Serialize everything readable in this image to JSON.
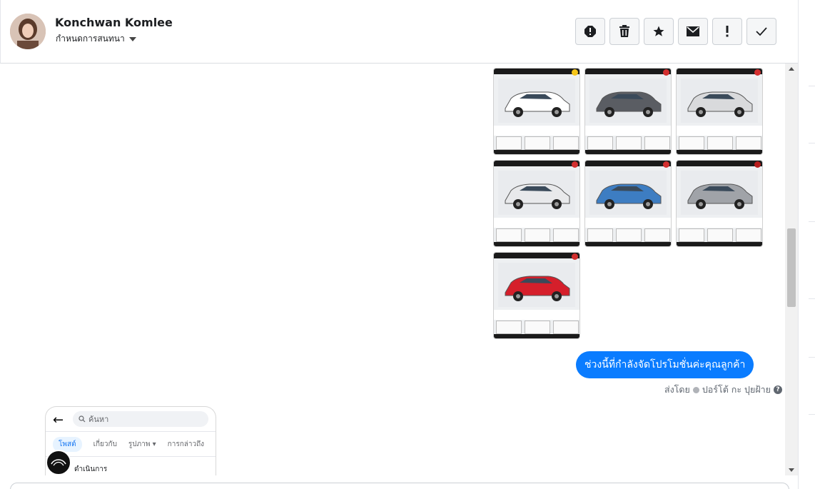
{
  "header": {
    "name": "Konchwan Komlee",
    "assign_label": "กำหนดการสนทนา",
    "actions": [
      {
        "name": "spam-icon",
        "label": "spam"
      },
      {
        "name": "trash-icon",
        "label": "delete"
      },
      {
        "name": "star-icon",
        "label": "star"
      },
      {
        "name": "envelope-icon",
        "label": "mark unread"
      },
      {
        "name": "exclamation-icon",
        "label": "follow up"
      },
      {
        "name": "check-icon",
        "label": "done"
      }
    ]
  },
  "thumbnails": [
    {
      "color": "#ffffff",
      "accent": "#f5c518"
    },
    {
      "color": "#5a5d63",
      "accent": "#d32f2f"
    },
    {
      "color": "#d9dadc",
      "accent": "#d32f2f"
    },
    {
      "color": "#e8e9eb",
      "accent": "#d32f2f"
    },
    {
      "color": "#3d7dc2",
      "accent": "#d32f2f"
    },
    {
      "color": "#a0a3a8",
      "accent": "#b71c1c"
    },
    {
      "color": "#d51f2b",
      "accent": "#d32f2f"
    }
  ],
  "message": {
    "text": "ช่วงนี้ที่กำลังจัดโปรโมชั่นค่ะคุณลูกค้า",
    "sent_by_prefix": "ส่งโดย",
    "sent_by_name": "ปอร์โต้ กะ ปุยฝ้าย",
    "bubble_color": "#0a7cff"
  },
  "phone_preview": {
    "search_placeholder": "ค้นหา",
    "tabs": [
      "โพสต์",
      "เกี่ยวกับ",
      "รูปภาพ",
      "การกล่าวถึง"
    ],
    "row1": "ดำเนินการ"
  }
}
